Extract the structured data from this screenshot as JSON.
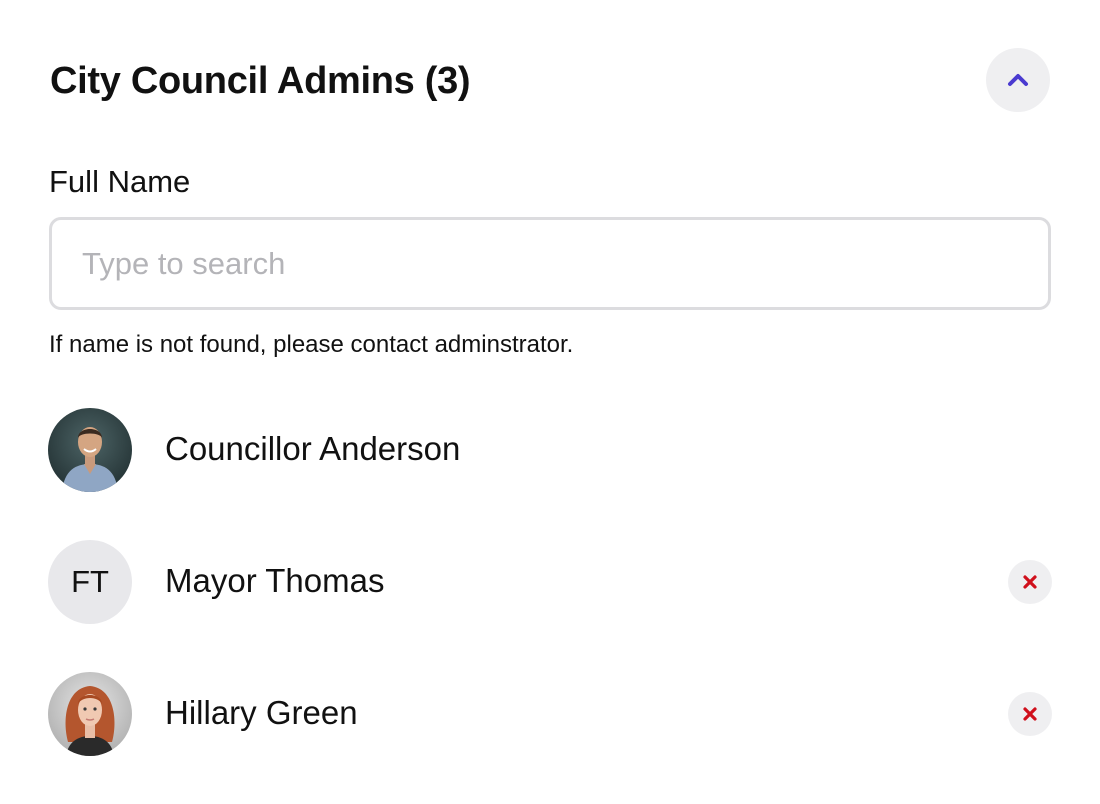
{
  "header": {
    "title": "City Council Admins (3)",
    "collapse_icon": "chevron-up-icon",
    "accent_color": "#4a3ad0"
  },
  "search": {
    "label": "Full Name",
    "placeholder": "Type to search",
    "value": "",
    "helper_text": "If name is not found, please contact adminstrator."
  },
  "admins": [
    {
      "name": "Councillor Anderson",
      "avatar_type": "photo",
      "initials": "",
      "removable": false
    },
    {
      "name": "Mayor Thomas",
      "avatar_type": "initials",
      "initials": "FT",
      "removable": true
    },
    {
      "name": "Hillary Green",
      "avatar_type": "photo",
      "initials": "",
      "removable": true
    }
  ],
  "colors": {
    "remove_icon": "#d0101c",
    "button_bg": "#efeff1",
    "input_border": "#dcdcdf",
    "placeholder": "#b4b4b8"
  }
}
